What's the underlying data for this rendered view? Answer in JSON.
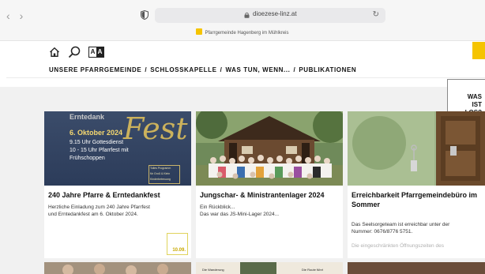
{
  "browser": {
    "url": "dioezese-linz.at",
    "tab_title": "Pfarrgemeinde Hagenberg im Mühlkreis",
    "back": "‹",
    "forward": "›",
    "reload": "↻"
  },
  "header": {
    "icons": [
      "home-icon",
      "search-icon",
      "font-size-icon"
    ],
    "font_size_left": "A",
    "font_size_right": "A",
    "menu": [
      "UNSERE PFARRGEMEINDE",
      "SCHLOSSKAPELLE",
      "WAS TUN, WENN...",
      "PUBLIKATIONEN"
    ],
    "menu_separator": "/"
  },
  "was_ist_los": [
    "WAS",
    "IST",
    "LOS?"
  ],
  "cards": [
    {
      "title": "240 Jahre Pfarre & Erntedankfest",
      "text": [
        "Herzliche Einladung zum 240 Jahre Pfarrfest",
        "und Erntedankfest am 6. Oktober 2024."
      ],
      "date": "10.09.",
      "flyer": {
        "word": "Erntedank",
        "date": "6. Oktober 2024",
        "line1": "9.15 Uhr Gottesdienst",
        "line2": "10 - 15 Uhr Pfarrfest mit",
        "line3": "Frühschoppen",
        "script": "Fest",
        "note": [
          "Tolles Programm",
          "für Groß & Klein",
          "Kinderbetreuung"
        ]
      }
    },
    {
      "title": "Jungschar- & Ministrantenlager 2024",
      "text": [
        "Ein Rückblick...",
        "Das war das JS-Mini-Lager 2024..."
      ]
    },
    {
      "title": "Erreichbarkeit Pfarrgemeindebüro im Sommer",
      "title_lines": [
        "Erreichbarkeit Pfarrgemeindebüro im",
        "Sommer"
      ],
      "text": [
        "Das Seelsorgeteam ist erreichbar unter der",
        "Nummer: 0676/8776 5751."
      ],
      "text_faded": "Die eingeschränkten Öffnungszeiten des"
    }
  ],
  "row2": {
    "left_text": "Die Wanderung",
    "right_text": "Die Route führt"
  },
  "colors": {
    "accent": "#f5c400",
    "date": "#c8a800",
    "flyer_bg": "#2c3c5a"
  }
}
